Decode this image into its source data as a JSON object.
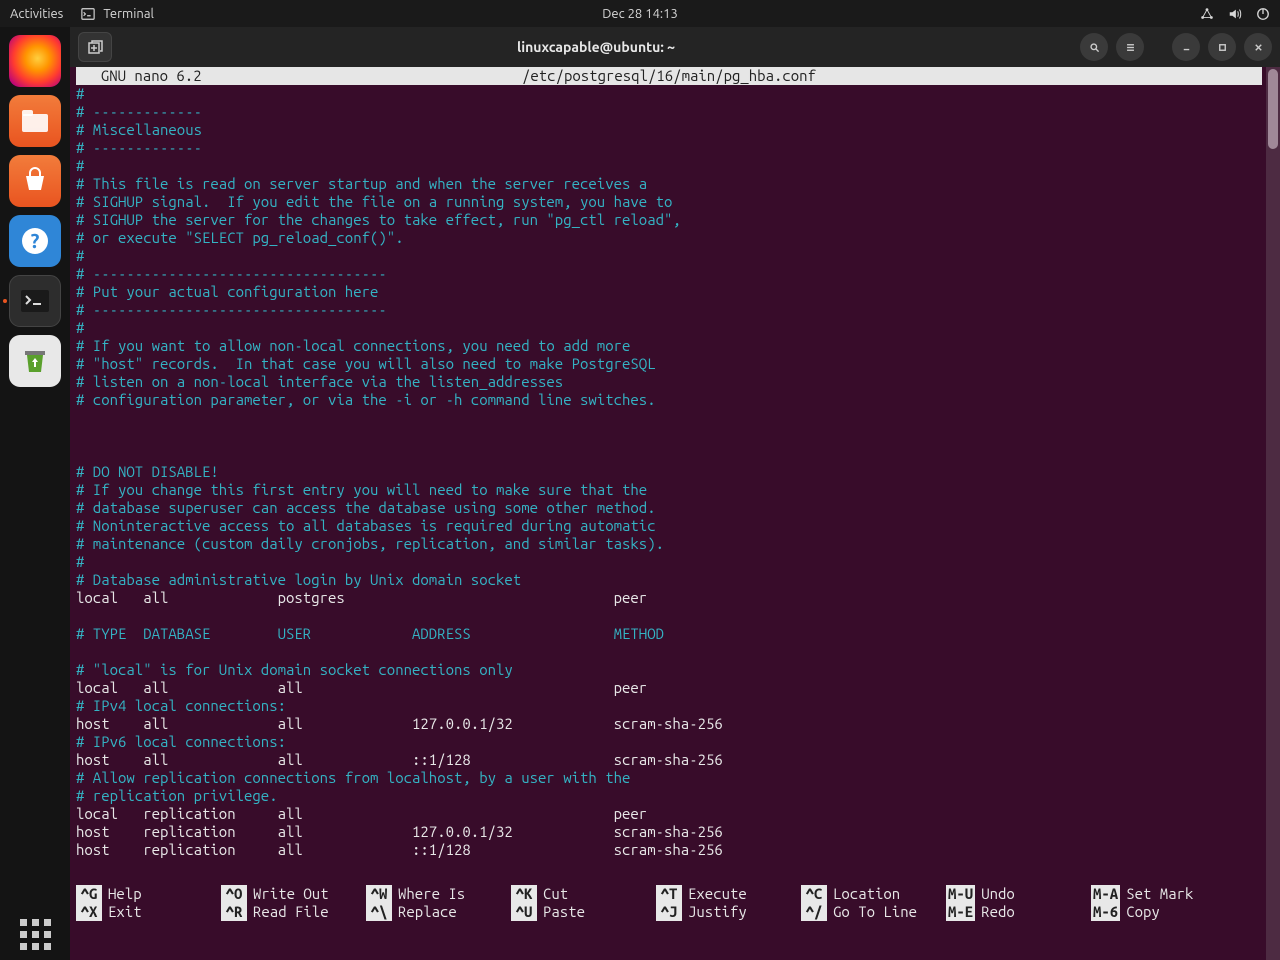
{
  "top_panel": {
    "activities": "Activities",
    "app_name": "Terminal",
    "clock": "Dec 28  14:13"
  },
  "dock": {
    "items": [
      "firefox",
      "files",
      "software",
      "help",
      "terminal",
      "trash"
    ],
    "active": "terminal"
  },
  "window": {
    "title": "linuxcapable@ubuntu: ~"
  },
  "nano": {
    "header_left": "  GNU nano 6.2",
    "header_file": "/etc/postgresql/16/main/pg_hba.conf"
  },
  "file_lines": [
    {
      "t": "#",
      "c": "comment"
    },
    {
      "t": "# -------------",
      "c": "comment"
    },
    {
      "t": "# Miscellaneous",
      "c": "comment"
    },
    {
      "t": "# -------------",
      "c": "comment"
    },
    {
      "t": "#",
      "c": "comment"
    },
    {
      "t": "# This file is read on server startup and when the server receives a",
      "c": "comment"
    },
    {
      "t": "# SIGHUP signal.  If you edit the file on a running system, you have to",
      "c": "comment"
    },
    {
      "t": "# SIGHUP the server for the changes to take effect, run \"pg_ctl reload\",",
      "c": "comment"
    },
    {
      "t": "# or execute \"SELECT pg_reload_conf()\".",
      "c": "comment"
    },
    {
      "t": "#",
      "c": "comment"
    },
    {
      "t": "# -----------------------------------",
      "c": "comment"
    },
    {
      "t": "# Put your actual configuration here",
      "c": "comment"
    },
    {
      "t": "# -----------------------------------",
      "c": "comment"
    },
    {
      "t": "#",
      "c": "comment"
    },
    {
      "t": "# If you want to allow non-local connections, you need to add more",
      "c": "comment"
    },
    {
      "t": "# \"host\" records.  In that case you will also need to make PostgreSQL",
      "c": "comment"
    },
    {
      "t": "# listen on a non-local interface via the listen_addresses",
      "c": "comment"
    },
    {
      "t": "# configuration parameter, or via the -i or -h command line switches.",
      "c": "comment"
    },
    {
      "t": "",
      "c": "plain"
    },
    {
      "t": "",
      "c": "plain"
    },
    {
      "t": "",
      "c": "plain"
    },
    {
      "t": "# DO NOT DISABLE!",
      "c": "comment"
    },
    {
      "t": "# If you change this first entry you will need to make sure that the",
      "c": "comment"
    },
    {
      "t": "# database superuser can access the database using some other method.",
      "c": "comment"
    },
    {
      "t": "# Noninteractive access to all databases is required during automatic",
      "c": "comment"
    },
    {
      "t": "# maintenance (custom daily cronjobs, replication, and similar tasks).",
      "c": "comment"
    },
    {
      "t": "#",
      "c": "comment"
    },
    {
      "t": "# Database administrative login by Unix domain socket",
      "c": "comment"
    },
    {
      "t": "local   all             postgres                                peer",
      "c": "plain"
    },
    {
      "t": "",
      "c": "plain"
    },
    {
      "t": "# TYPE  DATABASE        USER            ADDRESS                 METHOD",
      "c": "comment"
    },
    {
      "t": "",
      "c": "plain"
    },
    {
      "t": "# \"local\" is for Unix domain socket connections only",
      "c": "comment"
    },
    {
      "t": "local   all             all                                     peer",
      "c": "plain"
    },
    {
      "t": "# IPv4 local connections:",
      "c": "comment"
    },
    {
      "t": "host    all             all             127.0.0.1/32            scram-sha-256",
      "c": "plain"
    },
    {
      "t": "# IPv6 local connections:",
      "c": "comment"
    },
    {
      "t": "host    all             all             ::1/128                 scram-sha-256",
      "c": "plain"
    },
    {
      "t": "# Allow replication connections from localhost, by a user with the",
      "c": "comment"
    },
    {
      "t": "# replication privilege.",
      "c": "comment"
    },
    {
      "t": "local   replication     all                                     peer",
      "c": "plain"
    },
    {
      "t": "host    replication     all             127.0.0.1/32            scram-sha-256",
      "c": "plain"
    },
    {
      "t": "host    replication     all             ::1/128                 scram-sha-256",
      "c": "plain"
    }
  ],
  "shortcuts_row1": [
    {
      "key": "^G",
      "label": "Help"
    },
    {
      "key": "^O",
      "label": "Write Out"
    },
    {
      "key": "^W",
      "label": "Where Is"
    },
    {
      "key": "^K",
      "label": "Cut"
    },
    {
      "key": "^T",
      "label": "Execute"
    },
    {
      "key": "^C",
      "label": "Location"
    },
    {
      "key": "M-U",
      "label": "Undo"
    },
    {
      "key": "M-A",
      "label": "Set Mark"
    }
  ],
  "shortcuts_row2": [
    {
      "key": "^X",
      "label": "Exit"
    },
    {
      "key": "^R",
      "label": "Read File"
    },
    {
      "key": "^\\",
      "label": "Replace"
    },
    {
      "key": "^U",
      "label": "Paste"
    },
    {
      "key": "^J",
      "label": "Justify"
    },
    {
      "key": "^/",
      "label": "Go To Line"
    },
    {
      "key": "M-E",
      "label": "Redo"
    },
    {
      "key": "M-6",
      "label": "Copy"
    }
  ]
}
